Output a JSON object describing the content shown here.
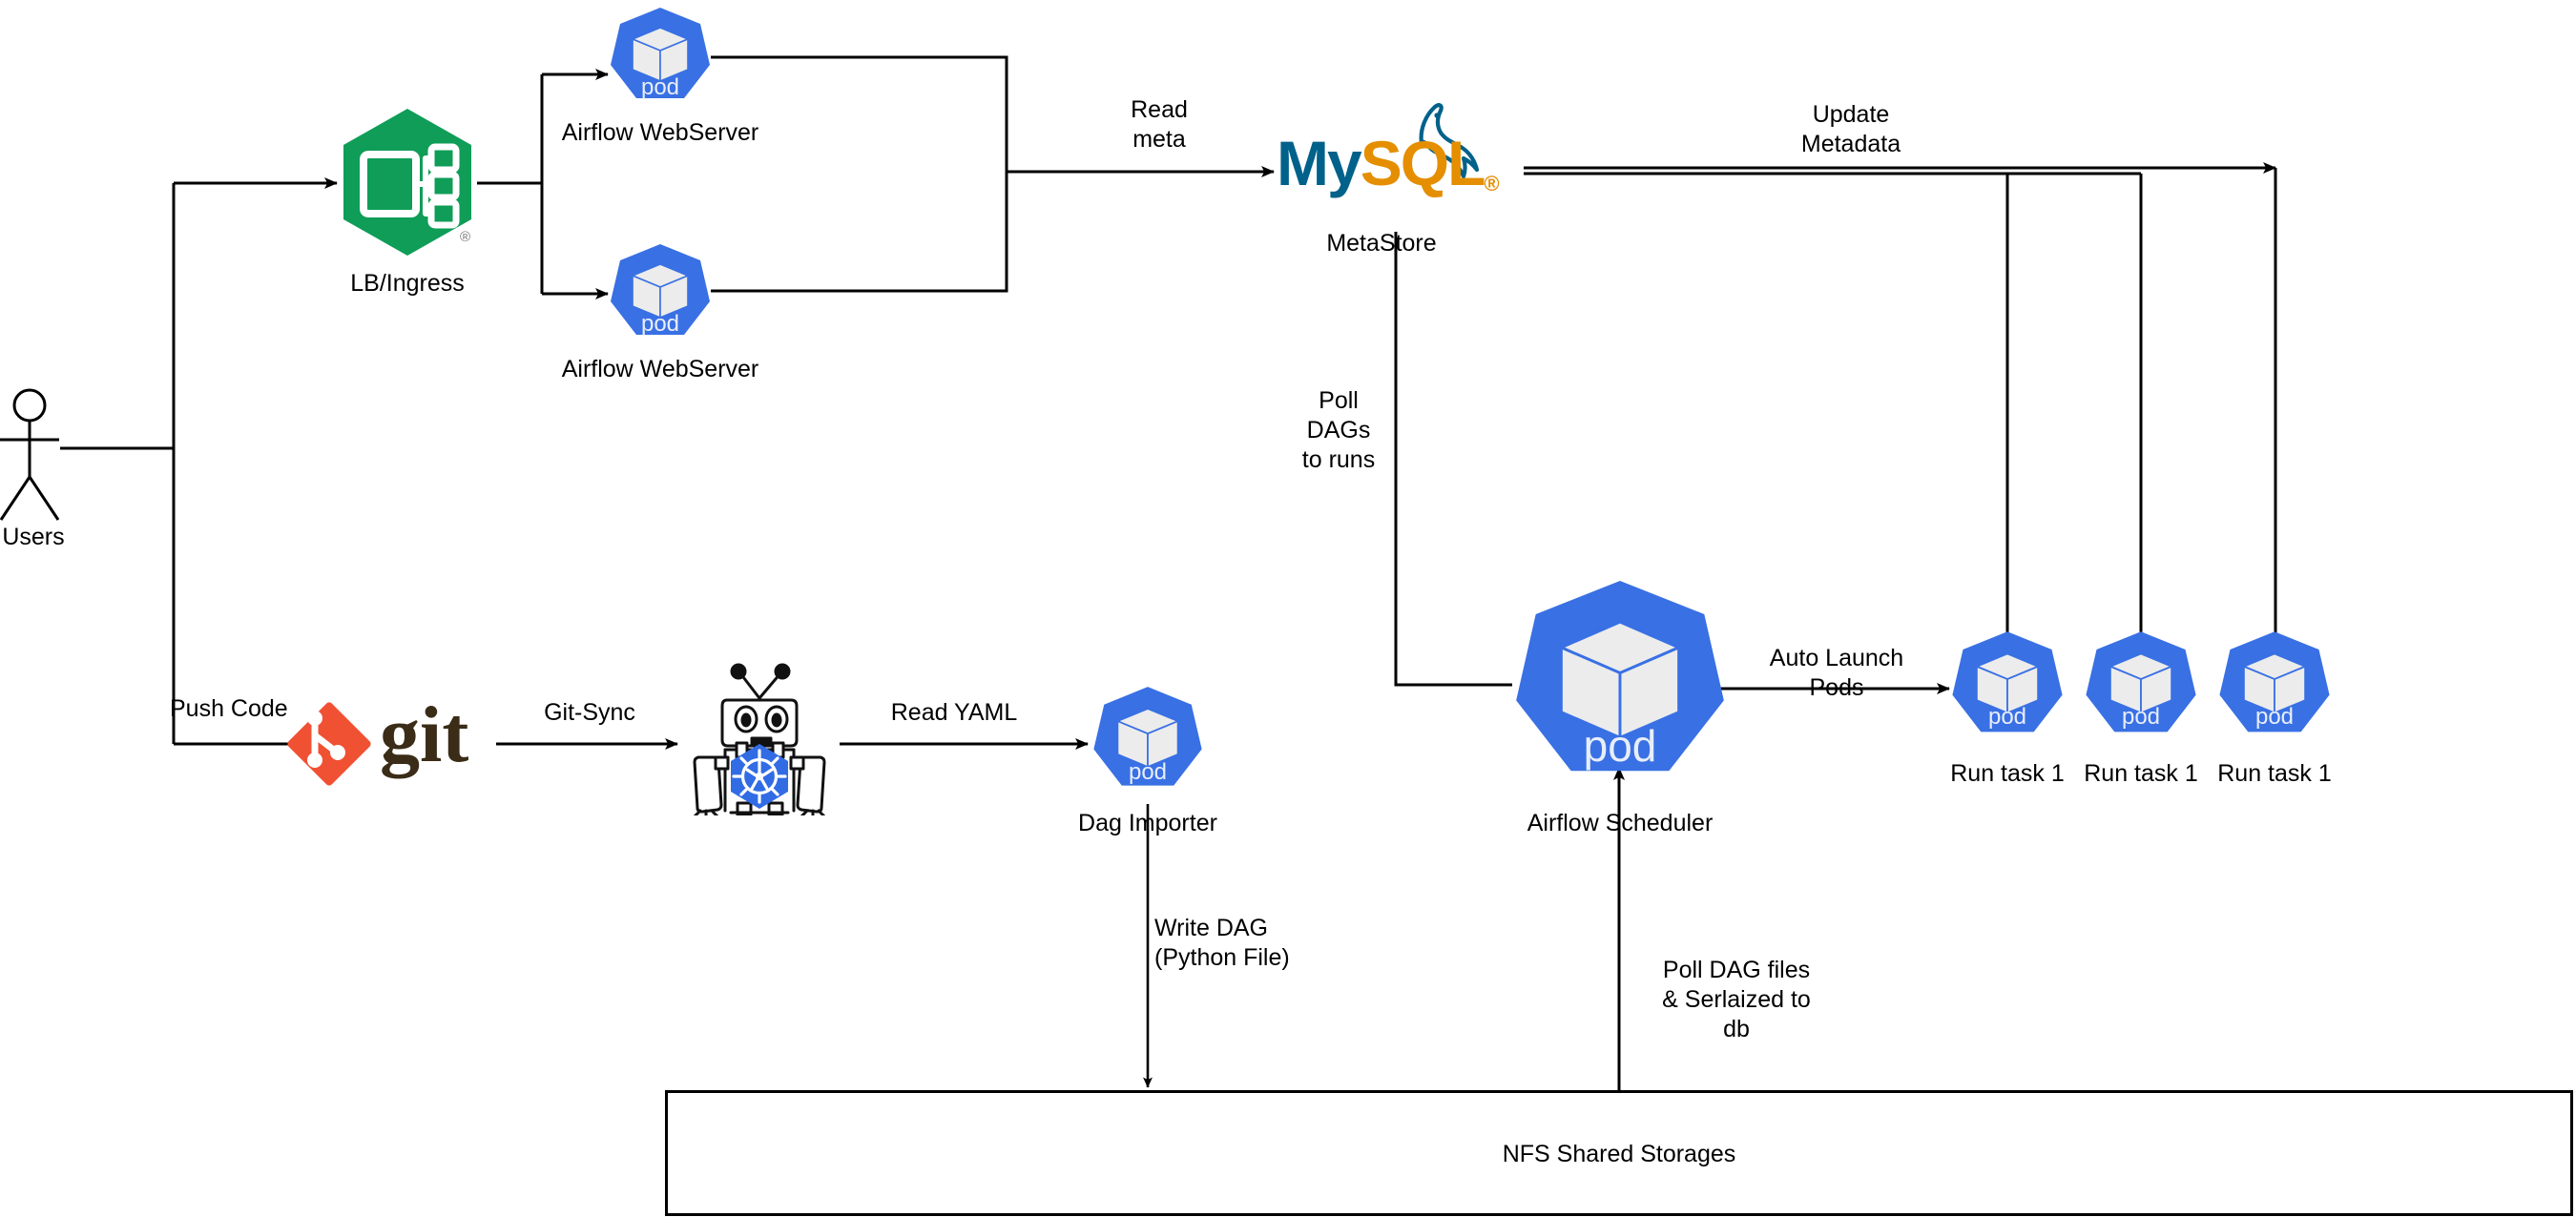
{
  "diagram": {
    "title": "Airflow on Kubernetes architecture",
    "background": "#ffffff",
    "line_color": "#000000",
    "colors": {
      "k8s_blue": "#326ce5",
      "pod_blue": "#3970e4",
      "ingress_green": "#0f9d58",
      "mysql_teal": "#00618a",
      "mysql_orange": "#e48e00",
      "git_red": "#f05133",
      "git_text": "#3b2c17",
      "cube_white": "#ececec"
    }
  },
  "nodes": {
    "users": {
      "label": "Users",
      "icon": "actor-icon"
    },
    "ingress": {
      "label": "LB/Ingress",
      "icon": "kubernetes-ingress-icon",
      "trademark": "®"
    },
    "webserver_1": {
      "label": "Airflow WebServer",
      "icon": "kubernetes-pod-icon",
      "pod_text": "pod"
    },
    "webserver_2": {
      "label": "Airflow WebServer",
      "icon": "kubernetes-pod-icon",
      "pod_text": "pod"
    },
    "metastore": {
      "label": "MetaStore",
      "icon": "mysql-logo-icon",
      "logo_my": "My",
      "logo_sql": "SQL",
      "logo_reg": "®"
    },
    "git": {
      "label": "",
      "icon": "git-logo-icon",
      "wordmark": "git"
    },
    "gitsync_robot": {
      "label": "",
      "icon": "kubernetes-robot-icon"
    },
    "dag_importer": {
      "label": "Dag Importer",
      "icon": "kubernetes-pod-icon",
      "pod_text": "pod"
    },
    "scheduler": {
      "label": "Airflow Scheduler",
      "icon": "kubernetes-pod-icon",
      "pod_text": "pod"
    },
    "task_pod_1": {
      "label": "Run task 1",
      "icon": "kubernetes-pod-icon",
      "pod_text": "pod"
    },
    "task_pod_2": {
      "label": "Run task 1",
      "icon": "kubernetes-pod-icon",
      "pod_text": "pod"
    },
    "task_pod_3": {
      "label": "Run task 1",
      "icon": "kubernetes-pod-icon",
      "pod_text": "pod"
    },
    "nfs": {
      "label": "NFS Shared Storages"
    }
  },
  "edges": {
    "read_meta": "Read\nmeta",
    "update_metadata": "Update\nMetadata",
    "poll_dags_to_runs": "Poll\nDAGs\nto runs",
    "push_code": "Push Code",
    "git_sync": "Git-Sync",
    "read_yaml": "Read YAML",
    "write_dag": "Write DAG\n(Python File)",
    "auto_launch_pods": "Auto Launch\nPods",
    "poll_dag_files": "Poll DAG files\n& Serlaized to\ndb"
  }
}
